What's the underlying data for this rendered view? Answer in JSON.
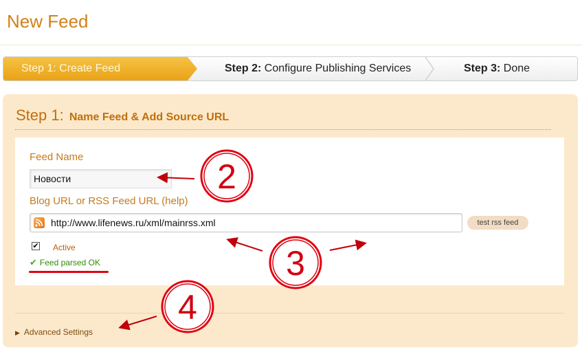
{
  "page": {
    "title": "New Feed"
  },
  "steps": [
    {
      "num": "Step 1:",
      "label": "Create Feed"
    },
    {
      "num": "Step 2:",
      "label": "Configure Publishing Services"
    },
    {
      "num": "Step 3:",
      "label": "Done"
    }
  ],
  "panel": {
    "step_prefix": "Step 1:",
    "title": "Name Feed & Add Source URL",
    "feed_name_label": "Feed Name",
    "feed_name_value": "Новости",
    "url_label": "Blog URL or RSS Feed URL (help)",
    "url_value": "http://www.lifenews.ru/xml/mainrss.xml",
    "test_button": "test rss feed",
    "active_label": "Active",
    "active_checked": true,
    "status_text": "Feed parsed OK",
    "advanced_label": "Advanced Settings"
  },
  "annotations": {
    "marker_2": "2",
    "marker_3": "3",
    "marker_4": "4",
    "color": "#e00010"
  }
}
